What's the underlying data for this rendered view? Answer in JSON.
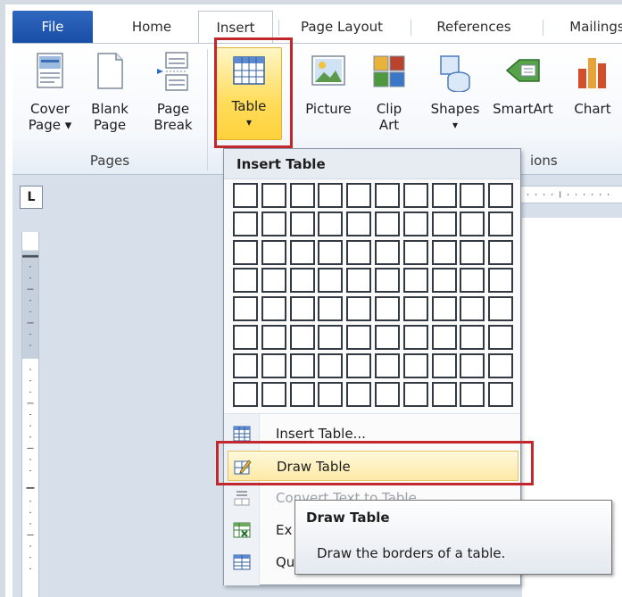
{
  "tabs": {
    "file": "File",
    "home": "Home",
    "insert": "Insert",
    "page_layout": "Page Layout",
    "references": "References",
    "mailings": "Mailings"
  },
  "ribbon": {
    "cover_page": [
      "Cover",
      "Page ▾"
    ],
    "blank_page": [
      "Blank",
      "Page"
    ],
    "page_break": [
      "Page",
      "Break"
    ],
    "table": [
      "Table",
      "▾"
    ],
    "picture": "Picture",
    "clip_art": [
      "Clip",
      "Art"
    ],
    "shapes": [
      "Shapes",
      "▾"
    ],
    "smartart": "SmartArt",
    "chart": "Chart",
    "group_pages": "Pages",
    "group_illustrations_partial": "ions"
  },
  "ruler_toggle": "L",
  "dropdown": {
    "header": "Insert Table",
    "grid_cols": 10,
    "grid_rows": 8,
    "items": {
      "insert_table": "Insert Table...",
      "draw_table": "Draw Table",
      "convert_text": "Convert Text to Table...",
      "excel": "Ex",
      "quick": "Qu"
    }
  },
  "tooltip": {
    "title": "Draw Table",
    "description": "Draw the borders of a table."
  },
  "colors": {
    "file_tab": "#1f55ad",
    "highlight_red": "#c0282d",
    "table_button": "#ffd94a"
  }
}
